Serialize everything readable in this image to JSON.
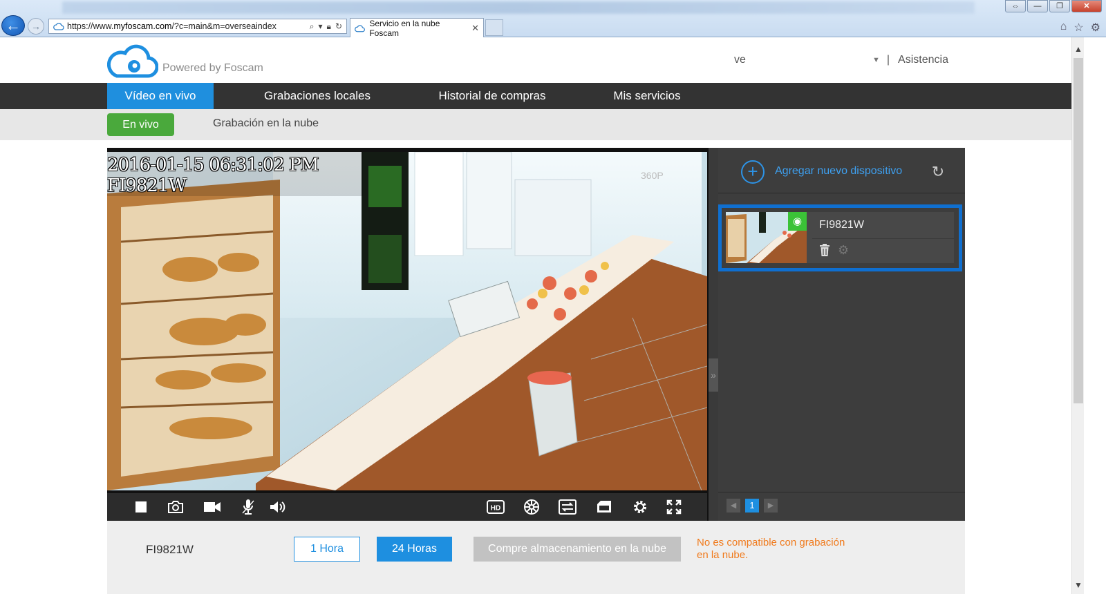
{
  "browser": {
    "url_prefix": "https://www.",
    "url_domain": "myfoscam.com",
    "url_path": "/?c=main&m=overseaindex",
    "tab_title": "Servicio en la nube Foscam",
    "tab_close": "✕",
    "window_buttons": [
      "⇔",
      "—",
      "❐",
      "✕"
    ]
  },
  "header": {
    "brand_text": "Powered by Foscam",
    "username": "ve",
    "help_label": "Asistencia",
    "separator": "|"
  },
  "main_nav": {
    "items": [
      {
        "label": "Vídeo en vivo",
        "active": true
      },
      {
        "label": "Grabaciones locales",
        "active": false
      },
      {
        "label": "Historial de compras",
        "active": false
      },
      {
        "label": "Mis servicios",
        "active": false
      }
    ]
  },
  "sub_nav": {
    "live_label": "En vivo",
    "cloud_label": "Grabación en la nube"
  },
  "video": {
    "timestamp": "2016-01-15 06:31:02 PM",
    "camera_label": "FI9821W",
    "resolution": "360P",
    "toolbar_icons": [
      "stop-icon",
      "snapshot-icon",
      "record-icon",
      "microphone-icon",
      "speaker-icon",
      "hd-icon",
      "brightness-icon",
      "flip-icon",
      "ir-mode-icon",
      "settings-icon",
      "fullscreen-icon"
    ],
    "hd_label": "HD"
  },
  "device_panel": {
    "add_label": "Agregar nuevo dispositivo",
    "devices": [
      {
        "name": "FI9821W",
        "online": true
      }
    ],
    "pager": {
      "current": "1",
      "prev": "◀",
      "next": "▶"
    }
  },
  "bottom_bar": {
    "device_name": "FI9821W",
    "btn_1h": "1 Hora",
    "btn_24h": "24 Horas",
    "btn_buy": "Compre almacenamiento en la nube",
    "warning": "No es compatible con grabación en la nube."
  },
  "colors": {
    "accent_blue": "#1f8fde",
    "live_green": "#4aa93c",
    "warning_orange": "#f07a1c",
    "nav_dark": "#333333"
  }
}
